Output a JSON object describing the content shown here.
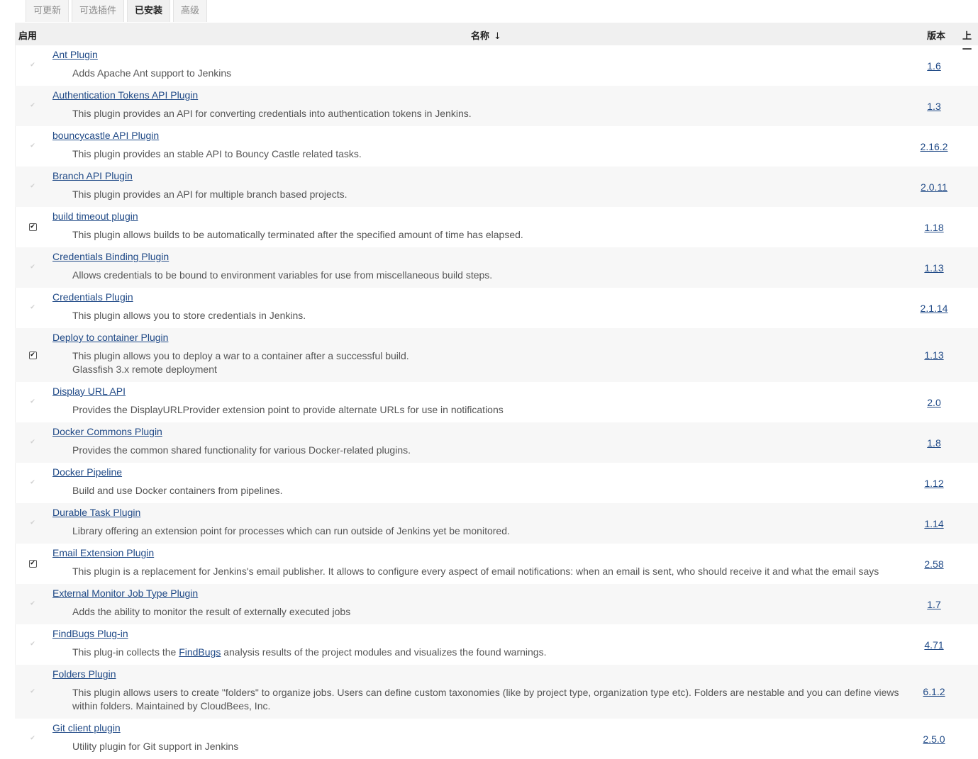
{
  "tabs": [
    {
      "label": "可更新",
      "active": false
    },
    {
      "label": "可选插件",
      "active": false
    },
    {
      "label": "已安装",
      "active": true
    },
    {
      "label": "高级",
      "active": false
    }
  ],
  "headers": {
    "enable": "启用",
    "name": "名称",
    "sort_arrow": "↓",
    "version": "版本",
    "previous": "上一"
  },
  "plugins": [
    {
      "name": "Ant Plugin",
      "desc": [
        "Adds Apache Ant support to Jenkins"
      ],
      "version": "1.6",
      "enabled": false
    },
    {
      "name": "Authentication Tokens API Plugin",
      "desc": [
        "This plugin provides an API for converting credentials into authentication tokens in Jenkins."
      ],
      "version": "1.3",
      "enabled": false
    },
    {
      "name": "bouncycastle API Plugin",
      "desc": [
        "This plugin provides an stable API to Bouncy Castle related tasks."
      ],
      "version": "2.16.2",
      "enabled": false
    },
    {
      "name": "Branch API Plugin",
      "desc": [
        "This plugin provides an API for multiple branch based projects."
      ],
      "version": "2.0.11",
      "enabled": false
    },
    {
      "name": "build timeout plugin",
      "desc": [
        "This plugin allows builds to be automatically terminated after the specified amount of time has elapsed."
      ],
      "version": "1.18",
      "enabled": true
    },
    {
      "name": "Credentials Binding Plugin",
      "desc": [
        "Allows credentials to be bound to environment variables for use from miscellaneous build steps."
      ],
      "version": "1.13",
      "enabled": false
    },
    {
      "name": "Credentials Plugin",
      "desc": [
        "This plugin allows you to store credentials in Jenkins."
      ],
      "version": "2.1.14",
      "enabled": false
    },
    {
      "name": "Deploy to container Plugin",
      "desc": [
        "This plugin allows you to deploy a war to a container after a successful build.",
        "Glassfish 3.x remote deployment"
      ],
      "version": "1.13",
      "enabled": true
    },
    {
      "name": "Display URL API",
      "desc": [
        "Provides the DisplayURLProvider extension point to provide alternate URLs for use in notifications"
      ],
      "version": "2.0",
      "enabled": false
    },
    {
      "name": "Docker Commons Plugin",
      "desc": [
        "Provides the common shared functionality for various Docker-related plugins."
      ],
      "version": "1.8",
      "enabled": false
    },
    {
      "name": "Docker Pipeline",
      "desc": [
        "Build and use Docker containers from pipelines."
      ],
      "version": "1.12",
      "enabled": false
    },
    {
      "name": "Durable Task Plugin",
      "desc": [
        "Library offering an extension point for processes which can run outside of Jenkins yet be monitored."
      ],
      "version": "1.14",
      "enabled": false
    },
    {
      "name": "Email Extension Plugin",
      "desc": [
        "This plugin is a replacement for Jenkins's email publisher. It allows to configure every aspect of email notifications: when an email is sent, who should receive it and what the email says"
      ],
      "version": "2.58",
      "enabled": true
    },
    {
      "name": "External Monitor Job Type Plugin",
      "desc": [
        "Adds the ability to monitor the result of externally executed jobs"
      ],
      "version": "1.7",
      "enabled": false
    },
    {
      "name": "FindBugs Plug-in",
      "desc_parts": [
        "This plug-in collects the ",
        "FindBugs",
        " analysis results of the project modules and visualizes the found warnings."
      ],
      "version": "4.71",
      "enabled": false
    },
    {
      "name": "Folders Plugin",
      "desc": [
        "This plugin allows users to create \"folders\" to organize jobs. Users can define custom taxonomies (like by project type, organization type etc). Folders are nestable and you can define views",
        "within folders. Maintained by CloudBees, Inc."
      ],
      "version": "6.1.2",
      "enabled": false
    },
    {
      "name": "Git client plugin",
      "desc": [
        "Utility plugin for Git support in Jenkins"
      ],
      "version": "2.5.0",
      "enabled": false
    }
  ]
}
